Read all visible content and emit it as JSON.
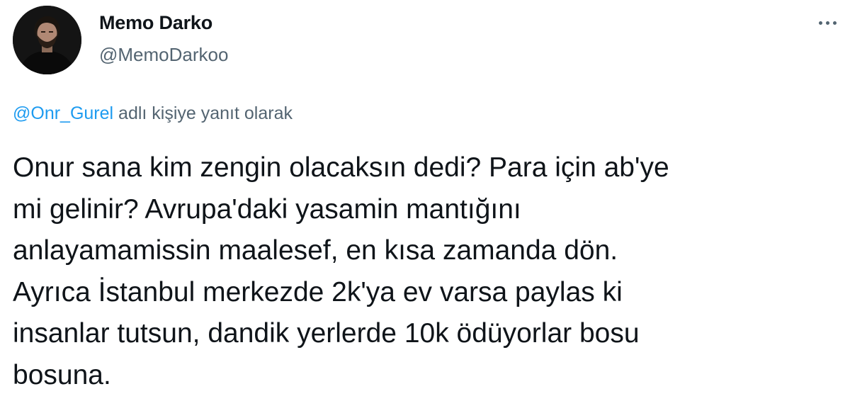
{
  "tweet": {
    "author": {
      "display_name": "Memo Darko",
      "handle": "@MemoDarkoo",
      "avatar_icon": "person-photo"
    },
    "more_icon": "more-options-icon",
    "reply_to": {
      "mention": "@Onr_Gurel",
      "suffix": " adlı kişiye yanıt olarak"
    },
    "text": "Onur sana kim zengin olacaksın dedi? Para için ab'ye\nmi gelinir? Avrupa'daki yasamin mantığını\nanlayamamissin maalesef, en kısa zamanda dön.\nAyrıca İstanbul merkezde 2k'ya ev varsa paylas ki\ninsanlar tutsun, dandik yerlerde 10k ödüyorlar bosu\nbosuna.",
    "colors": {
      "text": "#0f1419",
      "secondary": "#536471",
      "link": "#1d9bf0"
    }
  }
}
